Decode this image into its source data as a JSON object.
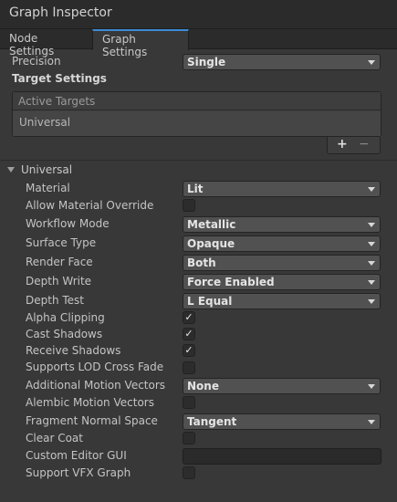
{
  "window": {
    "title": "Graph Inspector"
  },
  "tabs": [
    {
      "label": "Node Settings"
    },
    {
      "label": "Graph Settings"
    }
  ],
  "precision": {
    "label": "Precision",
    "value": "Single"
  },
  "target_settings": {
    "heading": "Target Settings",
    "list_header": "Active Targets",
    "items": [
      "Universal"
    ],
    "add_symbol": "+",
    "remove_symbol": "−"
  },
  "universal": {
    "label": "Universal",
    "material": {
      "label": "Material",
      "value": "Lit"
    },
    "allow_material_override": {
      "label": "Allow Material Override",
      "checked": false
    },
    "workflow_mode": {
      "label": "Workflow Mode",
      "value": "Metallic"
    },
    "surface_type": {
      "label": "Surface Type",
      "value": "Opaque"
    },
    "render_face": {
      "label": "Render Face",
      "value": "Both"
    },
    "depth_write": {
      "label": "Depth Write",
      "value": "Force Enabled"
    },
    "depth_test": {
      "label": "Depth Test",
      "value": "L Equal"
    },
    "alpha_clipping": {
      "label": "Alpha Clipping",
      "checked": true
    },
    "cast_shadows": {
      "label": "Cast Shadows",
      "checked": true
    },
    "receive_shadows": {
      "label": "Receive Shadows",
      "checked": true
    },
    "supports_lod_cross_fade": {
      "label": "Supports LOD Cross Fade",
      "checked": false
    },
    "additional_motion_vectors": {
      "label": "Additional Motion Vectors",
      "value": "None"
    },
    "alembic_motion_vectors": {
      "label": "Alembic Motion Vectors",
      "checked": false
    },
    "fragment_normal_space": {
      "label": "Fragment Normal Space",
      "value": "Tangent"
    },
    "clear_coat": {
      "label": "Clear Coat",
      "checked": false
    },
    "custom_editor_gui": {
      "label": "Custom Editor GUI",
      "value": ""
    },
    "support_vfx_graph": {
      "label": "Support VFX Graph",
      "checked": false
    }
  },
  "check_glyph": "✓"
}
